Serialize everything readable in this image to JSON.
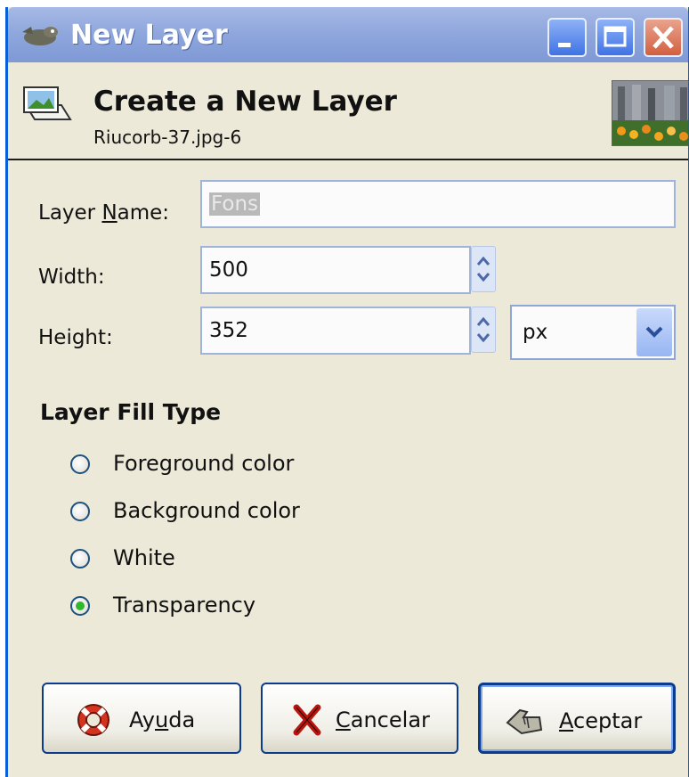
{
  "window": {
    "title": "New Layer",
    "controls": [
      "minimize",
      "maximize",
      "close"
    ]
  },
  "header": {
    "title": "Create a New Layer",
    "subtitle": "Riucorb-37.jpg-6"
  },
  "form": {
    "layer_name_label_pre": "Layer ",
    "layer_name_label_mn": "N",
    "layer_name_label_post": "ame:",
    "layer_name_value": "Fons",
    "width_label": "Width:",
    "width_value": "500",
    "height_label": "Height:",
    "height_value": "352",
    "unit_value": "px"
  },
  "fill": {
    "section_title": "Layer Fill Type",
    "options": [
      {
        "label": "Foreground color",
        "checked": false
      },
      {
        "label": "Background color",
        "checked": false
      },
      {
        "label": "White",
        "checked": false
      },
      {
        "label": "Transparency",
        "checked": true
      }
    ]
  },
  "buttons": {
    "help_pre": "Ay",
    "help_mn": "u",
    "help_post": "da",
    "cancel_mn": "C",
    "cancel_post": "ancelar",
    "ok_mn": "A",
    "ok_post": "ceptar"
  },
  "colors": {
    "titlebar": "#8ea6dc",
    "dialog_bg": "#ece9d8",
    "accent_border": "#0b3b8c",
    "radio_checked": "#2fb82b"
  }
}
